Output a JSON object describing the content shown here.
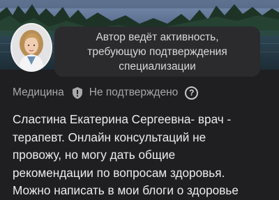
{
  "tooltip": {
    "lines": [
      "Автор ведёт активность,",
      "требующую подтверждения",
      "специализации"
    ]
  },
  "profile": {
    "category": "Медицина",
    "verification_status": "Не подтверждено",
    "shield_icon": "shield-exclamation-icon",
    "help_icon": "question-circle-icon",
    "bio_lines": [
      "Сластина Екатерина Сергеевна- врач -",
      "терапевт. Онлайн консультаций не",
      "провожу, но могу дать общие",
      "рекомендации по вопросам здоровья.",
      "Можно написать в мои блоги о здоровье"
    ]
  },
  "colors": {
    "background": "#1f1f21",
    "tooltip_bg": "#2b2b2e",
    "muted_text": "#a9a9ad",
    "body_text": "#ececef"
  }
}
